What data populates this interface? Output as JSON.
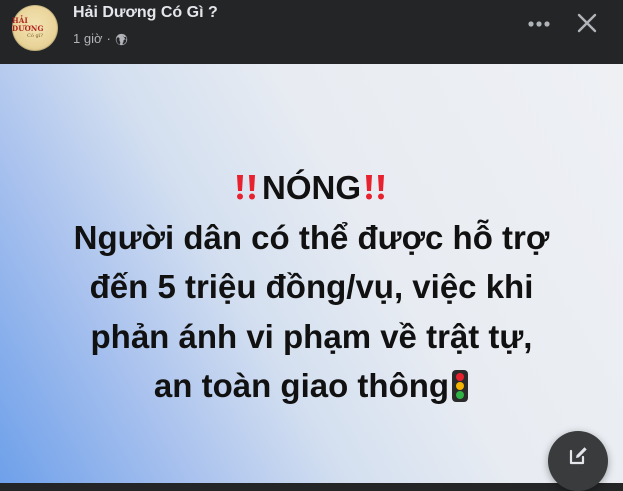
{
  "header": {
    "page_name": "Hải Dương Có Gì ?",
    "time": "1 giờ",
    "separator": "·",
    "avatar_text": "HẢI DƯƠNG",
    "avatar_subtext": "Có gì?"
  },
  "icons": {
    "privacy": "globe-icon",
    "more": "more-horizontal-icon",
    "close": "close-icon",
    "edit": "compose-icon"
  },
  "post": {
    "line1": "NÓNG",
    "line2": "Người dân có thể được hỗ trợ",
    "line3": "đến 5 triệu đồng/vụ, việc khi",
    "line4": "phản ánh vi phạm về trật tự,",
    "line5": "an toàn giao thông"
  },
  "colors": {
    "background": "#242526",
    "text_primary": "#e4e6eb",
    "text_secondary": "#b0b3b8",
    "headline": "#111111",
    "emoji_red": "#e8212e"
  }
}
